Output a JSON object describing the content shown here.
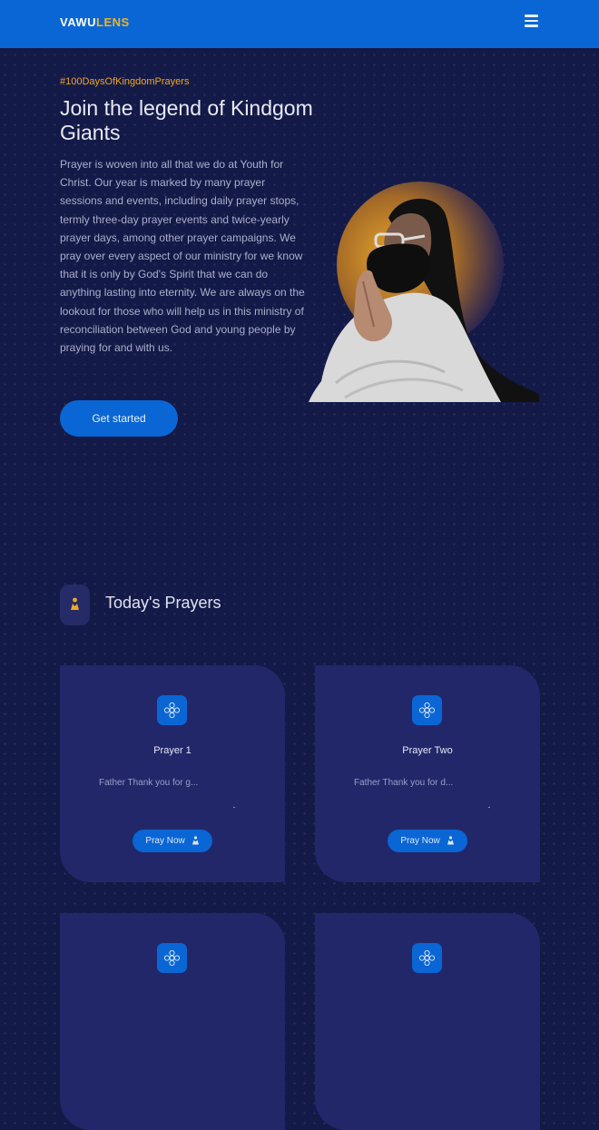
{
  "header": {
    "brand_primary": "VAWU",
    "brand_accent": "LENS",
    "menu_icon": "hamburger-icon"
  },
  "hero": {
    "hashtag": "#100DaysOfKingdomPrayers",
    "title": "Join the legend of Kindgom Giants",
    "body": "Prayer is woven into all that we do at Youth for Christ. Our year is marked by many prayer sessions and events, including daily prayer stops, termly three-day prayer events and twice-yearly prayer days, among other prayer campaigns. We pray over every aspect of our ministry for we know that it is only by God's Spirit that we can do anything lasting into eternity. We are always on the lookout for those who will help us in this ministry of reconciliation between God and young people by praying for and with us.",
    "cta_label": "Get started",
    "image": "woman-praying-with-mask"
  },
  "prayers_section": {
    "title": "Today's Prayers",
    "icon": "praying-person-icon",
    "cards": [
      {
        "title": "Prayer 1",
        "excerpt": "Father Thank you for g...",
        "button": "Pray Now"
      },
      {
        "title": "Prayer Two",
        "excerpt": "Father Thank you for d...",
        "button": "Pray Now"
      },
      {
        "title": "",
        "excerpt": "",
        "button": ""
      },
      {
        "title": "",
        "excerpt": "",
        "button": ""
      }
    ]
  },
  "colors": {
    "nav_blue": "#0a66d4",
    "page_bg": "#141a47",
    "card_bg": "#22276a",
    "accent_orange": "#f2a623"
  }
}
